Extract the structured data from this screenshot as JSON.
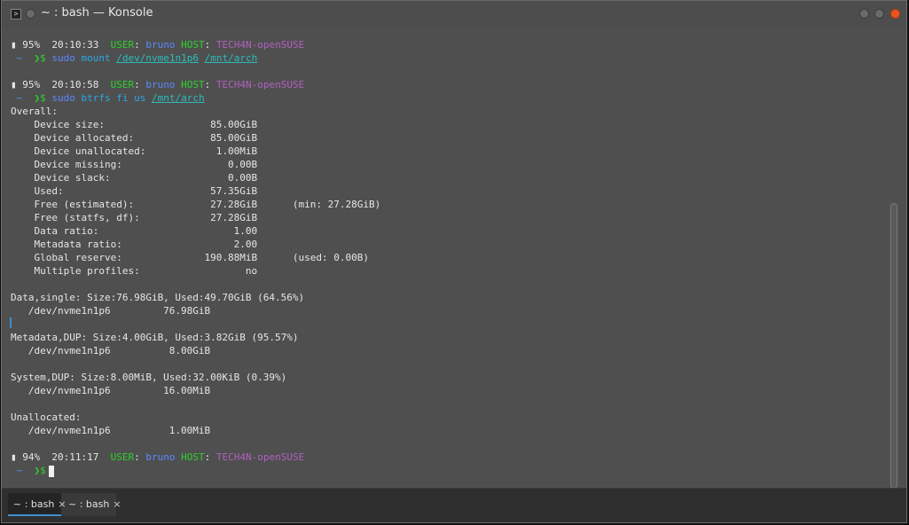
{
  "window": {
    "title": "~ : bash — Konsole",
    "app_icon": ">"
  },
  "prompts": [
    {
      "battery": "95%",
      "time": "20:10:33",
      "user_label": "USER",
      "user": "bruno",
      "host_label": "HOST",
      "host": "TECH4N-openSUSE",
      "dir": "~",
      "sep": "❯$",
      "sudo": "sudo",
      "cmd": "mount",
      "arg1": "/dev/nvme1n1p6",
      "arg2": "/mnt/arch"
    },
    {
      "battery": "95%",
      "time": "20:10:58",
      "user_label": "USER",
      "user": "bruno",
      "host_label": "HOST",
      "host": "TECH4N-openSUSE",
      "dir": "~",
      "sep": "❯$",
      "sudo": "sudo",
      "cmd": "btrfs fi us",
      "arg1": "/mnt/arch"
    },
    {
      "battery": "94%",
      "time": "20:11:17",
      "user_label": "USER",
      "user": "bruno",
      "host_label": "HOST",
      "host": "TECH4N-openSUSE",
      "dir": "~",
      "sep": "❯$"
    }
  ],
  "output": [
    "Overall:",
    "    Device size:                  85.00GiB",
    "    Device allocated:             85.00GiB",
    "    Device unallocated:            1.00MiB",
    "    Device missing:                  0.00B",
    "    Device slack:                    0.00B",
    "    Used:                         57.35GiB",
    "    Free (estimated):             27.28GiB      (min: 27.28GiB)",
    "    Free (statfs, df):            27.28GiB",
    "    Data ratio:                       1.00",
    "    Metadata ratio:                   2.00",
    "    Global reserve:              190.88MiB      (used: 0.00B)",
    "    Multiple profiles:                  no",
    "",
    "Data,single: Size:76.98GiB, Used:49.70GiB (64.56%)",
    "   /dev/nvme1n1p6         76.98GiB",
    "",
    "Metadata,DUP: Size:4.00GiB, Used:3.82GiB (95.57%)",
    "   /dev/nvme1n1p6          8.00GiB",
    "",
    "System,DUP: Size:8.00MiB, Used:32.00KiB (0.39%)",
    "   /dev/nvme1n1p6         16.00MiB",
    "",
    "Unallocated:",
    "   /dev/nvme1n1p6          1.00MiB"
  ],
  "tabs": [
    {
      "label": "~ : bash",
      "close": "×"
    },
    {
      "label": "~ : bash",
      "close": "×"
    }
  ]
}
